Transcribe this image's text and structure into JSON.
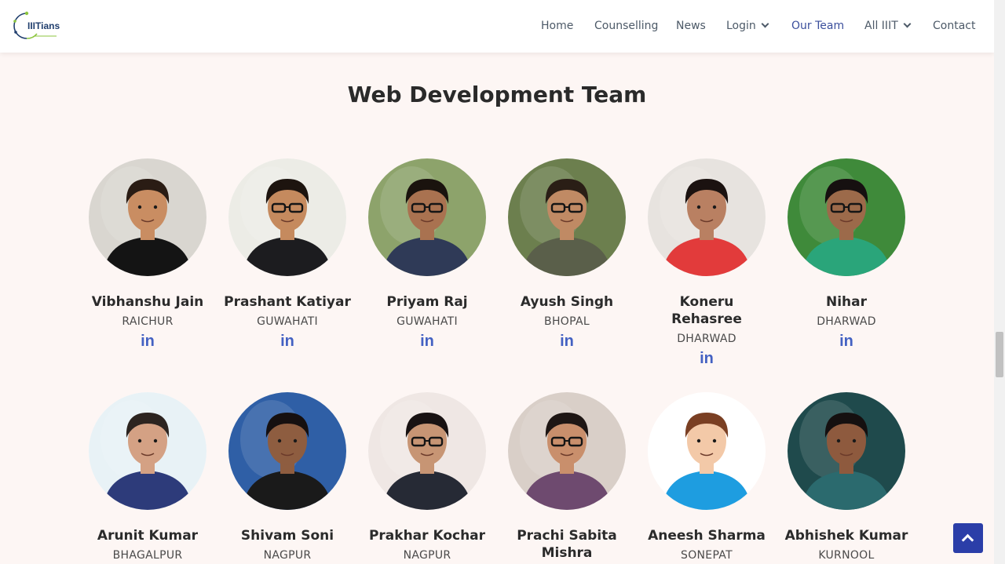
{
  "header": {
    "logo_text": "IIITians",
    "nav": [
      {
        "label": "Home",
        "active": false,
        "dropdown": false
      },
      {
        "label": "Counselling",
        "active": false,
        "dropdown": false
      },
      {
        "label": "News",
        "active": false,
        "dropdown": false
      },
      {
        "label": "Login",
        "active": false,
        "dropdown": true
      },
      {
        "label": "Our Team",
        "active": true,
        "dropdown": false
      },
      {
        "label": "All IIIT",
        "active": false,
        "dropdown": true
      },
      {
        "label": "Contact",
        "active": false,
        "dropdown": false
      }
    ]
  },
  "section": {
    "title": "Web Development Team"
  },
  "members": [
    {
      "name": "Vibhanshu Jain",
      "campus": "RAICHUR",
      "linkedin": "in",
      "photo": {
        "bg": "#d9d6d0",
        "skin": "#c98d62",
        "hair": "#2a1c14",
        "shirt": "#141414",
        "glasses": false
      }
    },
    {
      "name": "Prashant Katiyar",
      "campus": "GUWAHATI",
      "linkedin": "in",
      "photo": {
        "bg": "#ecece6",
        "skin": "#c58a5e",
        "hair": "#1d140f",
        "shirt": "#1c1c1f",
        "glasses": true
      }
    },
    {
      "name": "Priyam Raj",
      "campus": "GUWAHATI",
      "linkedin": "in",
      "photo": {
        "bg": "#8da36b",
        "skin": "#a97250",
        "hair": "#1a130e",
        "shirt": "#2f3a57",
        "glasses": true
      }
    },
    {
      "name": "Ayush Singh",
      "campus": "BHOPAL",
      "linkedin": "in",
      "photo": {
        "bg": "#6c7f4e",
        "skin": "#c08a64",
        "hair": "#2a1e16",
        "shirt": "#5a5f4a",
        "glasses": true
      }
    },
    {
      "name": "Koneru Rehasree",
      "campus": "DHARWAD",
      "linkedin": "in",
      "photo": {
        "bg": "#e7e3df",
        "skin": "#b98062",
        "hair": "#1b1210",
        "shirt": "#e23b3b",
        "glasses": false
      }
    },
    {
      "name": "Nihar",
      "campus": "DHARWAD",
      "linkedin": "in",
      "photo": {
        "bg": "#3f8a3a",
        "skin": "#9c6a4a",
        "hair": "#161010",
        "shirt": "#2aa57a",
        "glasses": true
      }
    },
    {
      "name": "Arunit Kumar",
      "campus": "BHAGALPUR",
      "linkedin": "in",
      "photo": {
        "bg": "#e8f2f6",
        "skin": "#d4a184",
        "hair": "#2c2420",
        "shirt": "#2d3b7a",
        "glasses": false
      }
    },
    {
      "name": "Shivam Soni",
      "campus": "NAGPUR",
      "linkedin": "in",
      "photo": {
        "bg": "#2f5fa6",
        "skin": "#8e5d40",
        "hair": "#161010",
        "shirt": "#1a1a1a",
        "glasses": false
      }
    },
    {
      "name": "Prakhar Kochar",
      "campus": "NAGPUR",
      "linkedin": "in",
      "photo": {
        "bg": "#efe7e4",
        "skin": "#c79574",
        "hair": "#181212",
        "shirt": "#262a35",
        "glasses": true
      }
    },
    {
      "name": "Prachi Sabita Mishra",
      "campus": "",
      "linkedin": "in",
      "photo": {
        "bg": "#d9cfc8",
        "skin": "#c98f6c",
        "hair": "#1e1614",
        "shirt": "#6e4a6f",
        "glasses": true
      }
    },
    {
      "name": "Aneesh Sharma",
      "campus": "SONEPAT",
      "linkedin": "in",
      "photo": {
        "bg": "#ffffff",
        "skin": "#f3c9a8",
        "hair": "#7a3f23",
        "shirt": "#1e9de0",
        "glasses": false
      }
    },
    {
      "name": "Abhishek Kumar",
      "campus": "KURNOOL",
      "linkedin": "in",
      "photo": {
        "bg": "#1f4a4c",
        "skin": "#8e5a3e",
        "hair": "#151010",
        "shirt": "#2b6a6e",
        "glasses": false
      }
    }
  ],
  "icons": {
    "logo": "iiitians-logo",
    "linkedin": "linkedin-icon",
    "back_to_top": "chevron-up-icon"
  },
  "colors": {
    "accent": "#3b4f9c",
    "linkedin": "#4361c2",
    "back_to_top_bg": "#2b3ea8",
    "page_bg": "#fdf6f4"
  }
}
